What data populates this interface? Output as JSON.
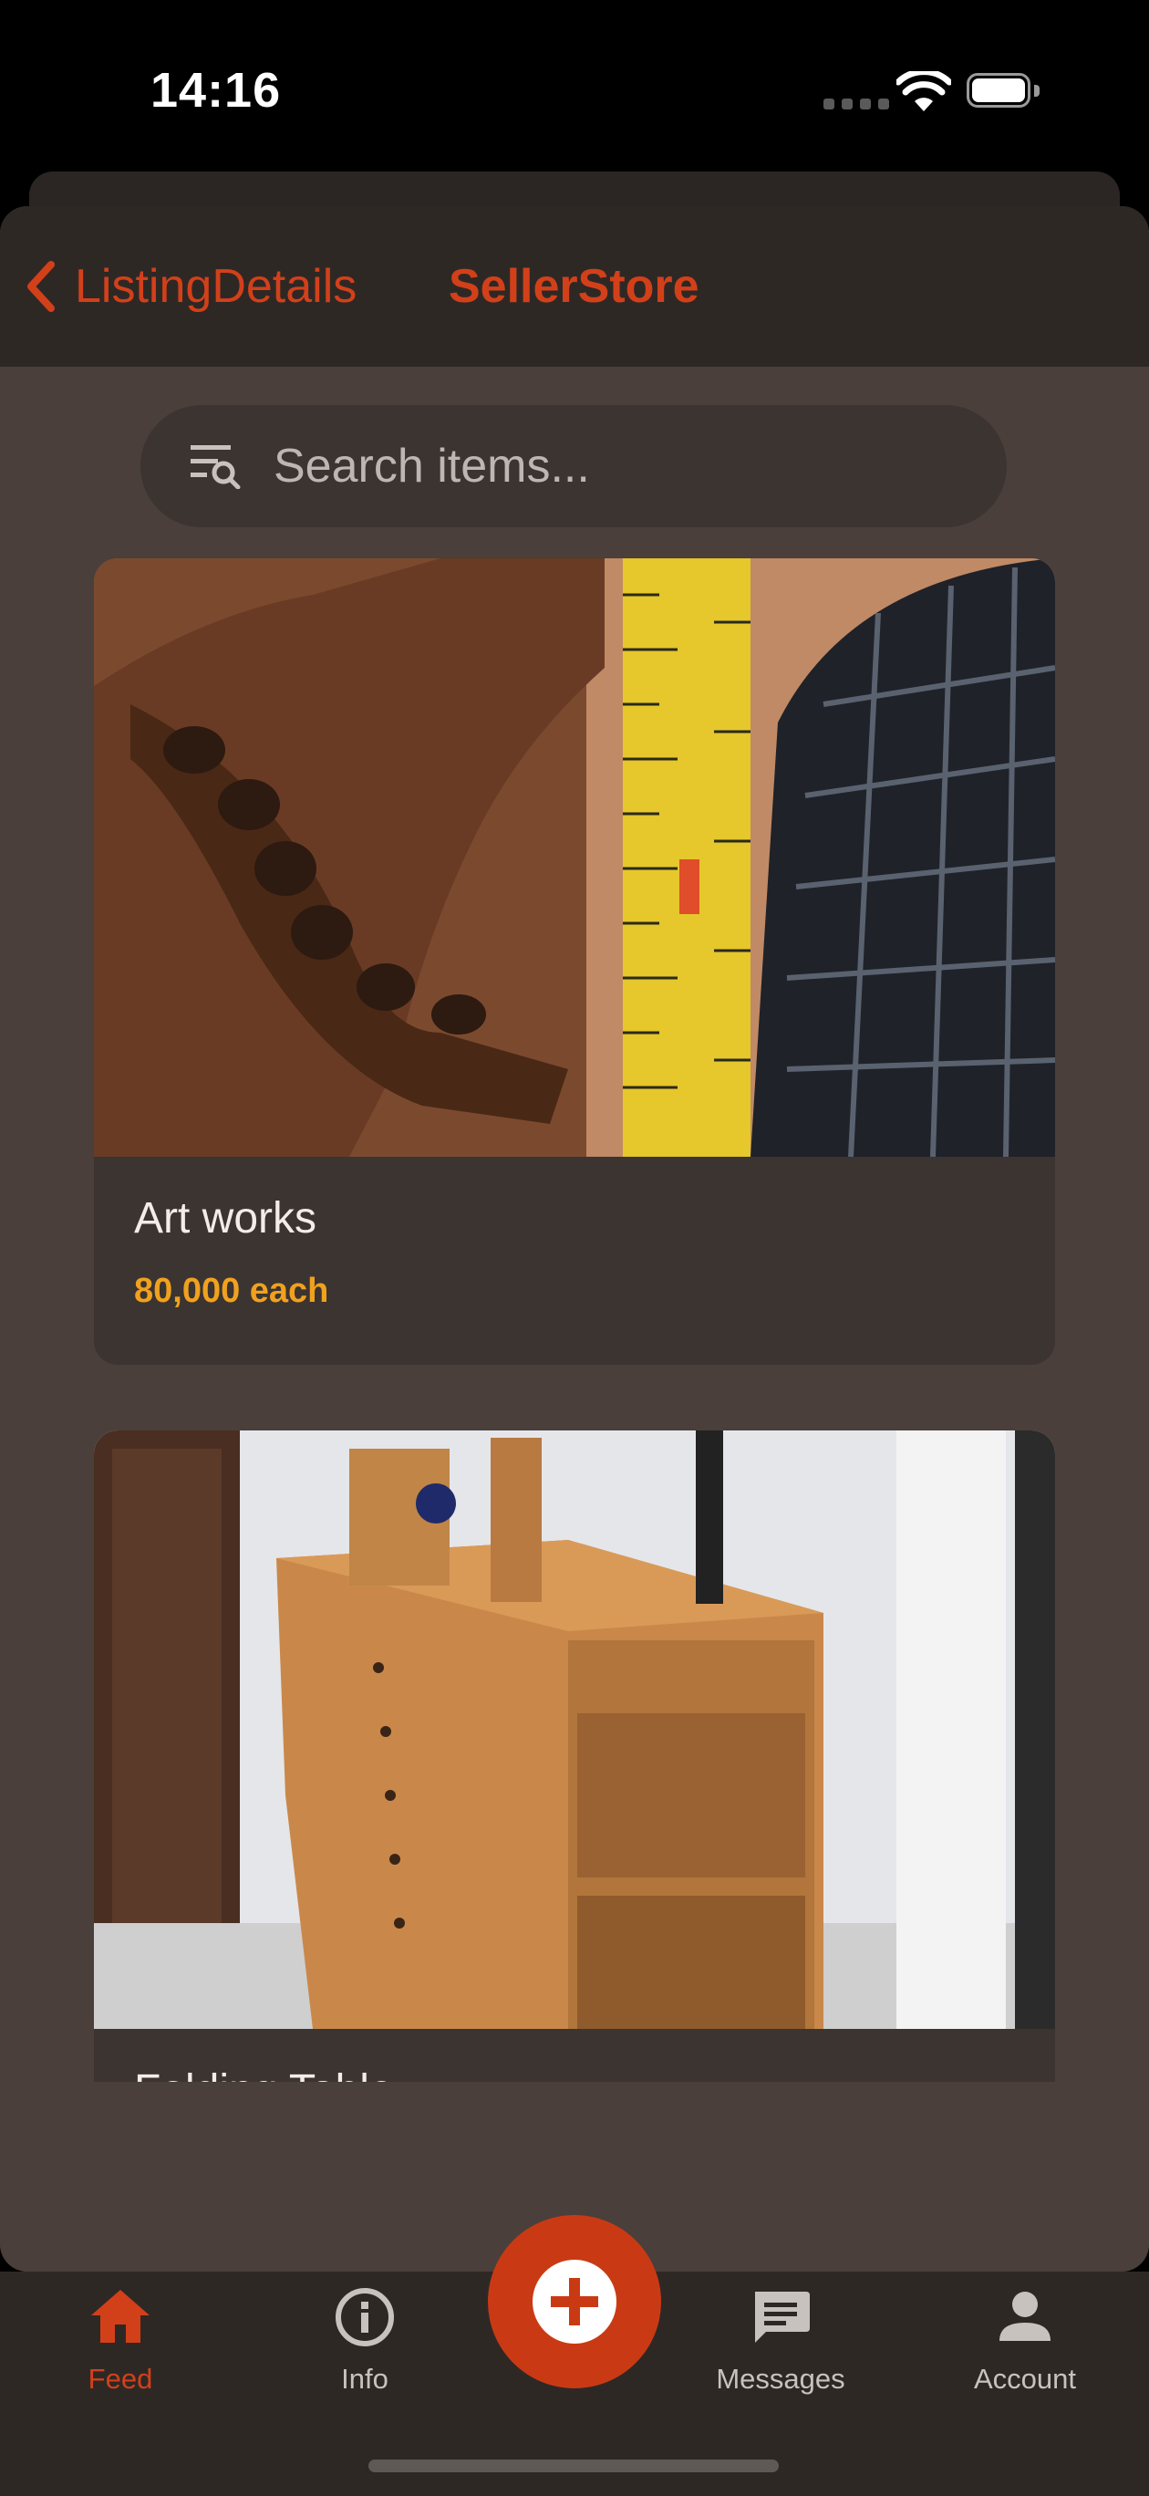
{
  "status_bar": {
    "time": "14:16"
  },
  "header": {
    "back_label": "ListingDetails",
    "title": "SellerStore"
  },
  "search": {
    "placeholder": "Search items..."
  },
  "listings": [
    {
      "title": "Art works",
      "price": "80,000 each",
      "image": "wood-carvings-with-tape-measure"
    },
    {
      "title": "Folding Table",
      "price": "",
      "image": "wooden-cabinet"
    }
  ],
  "tab_bar": {
    "items": [
      {
        "label": "Feed",
        "icon": "home-icon",
        "active": true
      },
      {
        "label": "Info",
        "icon": "info-icon",
        "active": false
      },
      {
        "label": "Messages",
        "icon": "message-icon",
        "active": false
      },
      {
        "label": "Account",
        "icon": "account-icon",
        "active": false
      }
    ],
    "fab_icon": "add-icon"
  },
  "colors": {
    "accent": "#d2401a",
    "price": "#f0a11e",
    "background": "#4a3f3b",
    "bar": "#2e2825"
  }
}
